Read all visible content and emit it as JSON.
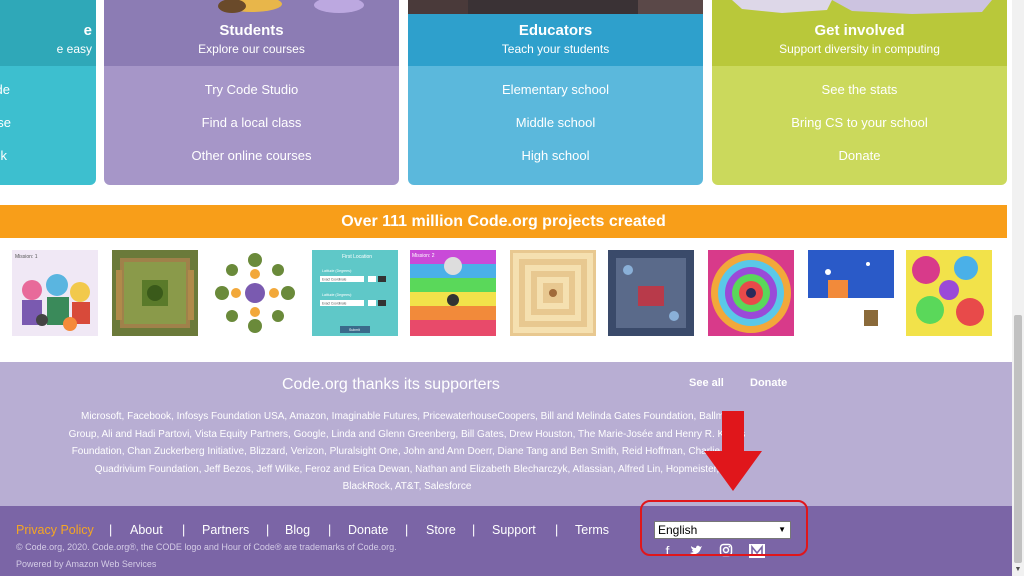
{
  "cards": {
    "hour_of_code": {
      "title": "e",
      "subtitle": "e easy",
      "links": [
        "de",
        "rse",
        "k"
      ]
    },
    "students": {
      "title": "Students",
      "subtitle": "Explore our courses",
      "links": [
        "Try Code Studio",
        "Find a local class",
        "Other online courses"
      ]
    },
    "educators": {
      "title": "Educators",
      "subtitle": "Teach your students",
      "links": [
        "Elementary school",
        "Middle school",
        "High school"
      ]
    },
    "get_involved": {
      "title": "Get involved",
      "subtitle": "Support diversity in computing",
      "links": [
        "See the stats",
        "Bring CS to your school",
        "Donate"
      ]
    }
  },
  "banner": {
    "text": "Over 111 million Code.org projects created"
  },
  "gallery": {
    "thumb_labels": [
      "Mission: 1",
      "First Location",
      "Mission: 2"
    ],
    "form_labels": [
      "Latitude (Degrees):",
      "Exact Coordinate",
      "Latitude (Degrees):",
      "Exact Coordinate",
      "Submit"
    ]
  },
  "supporters": {
    "title": "Code.org thanks its supporters",
    "see_all": "See all",
    "donate": "Donate",
    "lines": [
      "Microsoft, Facebook, Infosys Foundation USA, Amazon, Imaginable Futures, PricewaterhouseCoopers, Bill and Melinda Gates Foundation, Ballmer",
      "Group, Ali and Hadi Partovi, Vista Equity Partners, Google, Linda and Glenn Greenberg, Bill Gates, Drew Houston, The Marie-Josée and Henry R. Kravis",
      "Foundation, Chan Zuckerberg Initiative, Blizzard, Verizon, Pluralsight One, John and Ann Doerr, Diane Tang and Ben Smith, Reid Hoffman, Charlie Lee,",
      "Quadrivium Foundation, Jeff Bezos, Jeff Wilke, Feroz and Erica Dewan, Nathan and Elizabeth Blecharczyk, Atlassian, Alfred Lin, Hopmeister,",
      "BlackRock, AT&T, Salesforce"
    ]
  },
  "footer": {
    "links": {
      "privacy": "Privacy Policy",
      "about": "About",
      "partners": "Partners",
      "blog": "Blog",
      "donate": "Donate",
      "store": "Store",
      "support": "Support",
      "terms": "Terms"
    },
    "separator": "|",
    "copyright": "© Code.org, 2020. Code.org®, the CODE logo and Hour of Code® are trademarks of Code.org.",
    "powered_by": "Powered by Amazon Web Services",
    "language": {
      "selected": "English",
      "caret": "▼"
    },
    "social": {
      "facebook": "f",
      "twitter": "🐦",
      "instagram": "◎",
      "medium": "M"
    }
  },
  "colors": {
    "orange_banner": "#f89e19",
    "students_card": "#a696c8",
    "educators_card": "#5bb8dc",
    "involved_card": "#cbd95c",
    "footer": "#7b65a6",
    "supporters": "#b8aed3",
    "annotation_red": "#e0161b",
    "privacy_link": "#f5a623"
  },
  "icons": {
    "arrow": "down-arrow-annotation-icon",
    "highlight": "highlight-box-annotation"
  }
}
